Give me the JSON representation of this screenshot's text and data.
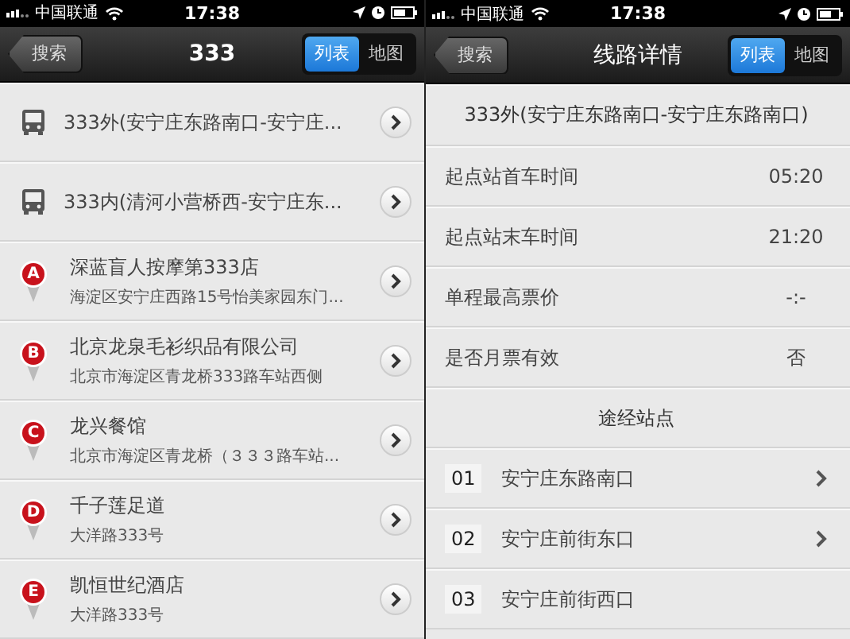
{
  "search_results_screen": {
    "status_bar": {
      "carrier": "中国联通",
      "time": "17:38"
    },
    "nav_bar": {
      "back": "搜索",
      "title": "333",
      "segments": [
        {
          "label": "列表",
          "selected": true
        },
        {
          "label": "地图",
          "selected": false
        }
      ]
    },
    "results": [
      {
        "kind": "bus",
        "title": "333外(安宁庄东路南口-安宁庄..."
      },
      {
        "kind": "bus",
        "title": "333内(清河小营桥西-安宁庄东..."
      },
      {
        "kind": "place",
        "marker": "A",
        "title": "深蓝盲人按摩第333店",
        "subtitle": "海淀区安宁庄西路15号怡美家园东门..."
      },
      {
        "kind": "place",
        "marker": "B",
        "title": "北京龙泉毛衫织品有限公司",
        "subtitle": "北京市海淀区青龙桥333路车站西侧"
      },
      {
        "kind": "place",
        "marker": "C",
        "title": "龙兴餐馆",
        "subtitle": "北京市海淀区青龙桥（３３３路车站..."
      },
      {
        "kind": "place",
        "marker": "D",
        "title": "千子莲足道",
        "subtitle": "大洋路333号"
      },
      {
        "kind": "place",
        "marker": "E",
        "title": "凯恒世纪酒店",
        "subtitle": "大洋路333号"
      }
    ]
  },
  "route_detail_screen": {
    "status_bar": {
      "carrier": "中国联通",
      "time": "17:38"
    },
    "nav_bar": {
      "back": "搜索",
      "title": "线路详情",
      "segments": [
        {
          "label": "列表",
          "selected": true
        },
        {
          "label": "地图",
          "selected": false
        }
      ]
    },
    "route_name": "333外(安宁庄东路南口-安宁庄东路南口)",
    "details": [
      {
        "label": "起点站首车时间",
        "value": "05:20"
      },
      {
        "label": "起点站末车时间",
        "value": "21:20"
      },
      {
        "label": "单程最高票价",
        "value": "-:-"
      },
      {
        "label": "是否月票有效",
        "value": "否"
      }
    ],
    "stops_heading": "途经站点",
    "stops": [
      {
        "number": "01",
        "name": "安宁庄东路南口",
        "arrow": true
      },
      {
        "number": "02",
        "name": "安宁庄前街东口",
        "arrow": true
      },
      {
        "number": "03",
        "name": "安宁庄前街西口",
        "arrow": false
      }
    ]
  }
}
